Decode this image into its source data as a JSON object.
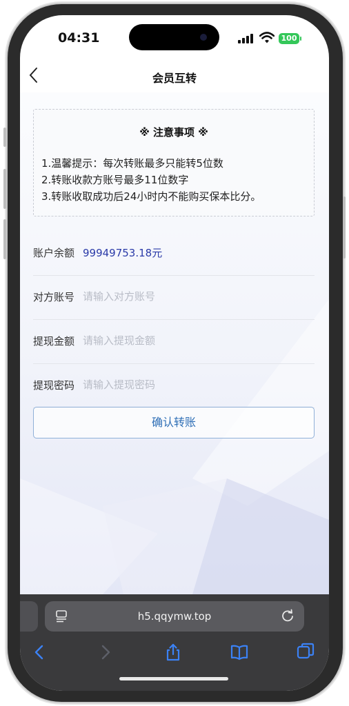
{
  "status_bar": {
    "time": "04:31",
    "battery": "100"
  },
  "navbar": {
    "title": "会员互转",
    "back_icon": "chevron-left-icon"
  },
  "notice": {
    "title": "※ 注意事项 ※",
    "lines": [
      "1.温馨提示：每次转账最多只能转5位数",
      "2.转账收款方账号最多11位数字",
      "3.转账收取成功后24小时内不能购买保本比分。"
    ]
  },
  "form": {
    "balance": {
      "label": "账户余额",
      "value": "99949753.18元"
    },
    "account": {
      "label": "对方账号",
      "placeholder": "请输入对方账号",
      "value": ""
    },
    "amount": {
      "label": "提现金额",
      "placeholder": "请输入提现金额",
      "value": ""
    },
    "password": {
      "label": "提现密码",
      "placeholder": "请输入提现密码",
      "value": ""
    },
    "confirm_label": "确认转账"
  },
  "browser": {
    "url": "h5.qqymw.top",
    "icons": [
      "reader-icon",
      "reload-icon",
      "back-arrow-icon",
      "forward-arrow-icon",
      "share-icon",
      "bookmarks-icon",
      "tabs-icon"
    ]
  },
  "colors": {
    "accent": "#2f6fb6",
    "balance_value": "#2a3aa8",
    "battery": "#34c759",
    "toolbar": "#3a3a3c"
  }
}
